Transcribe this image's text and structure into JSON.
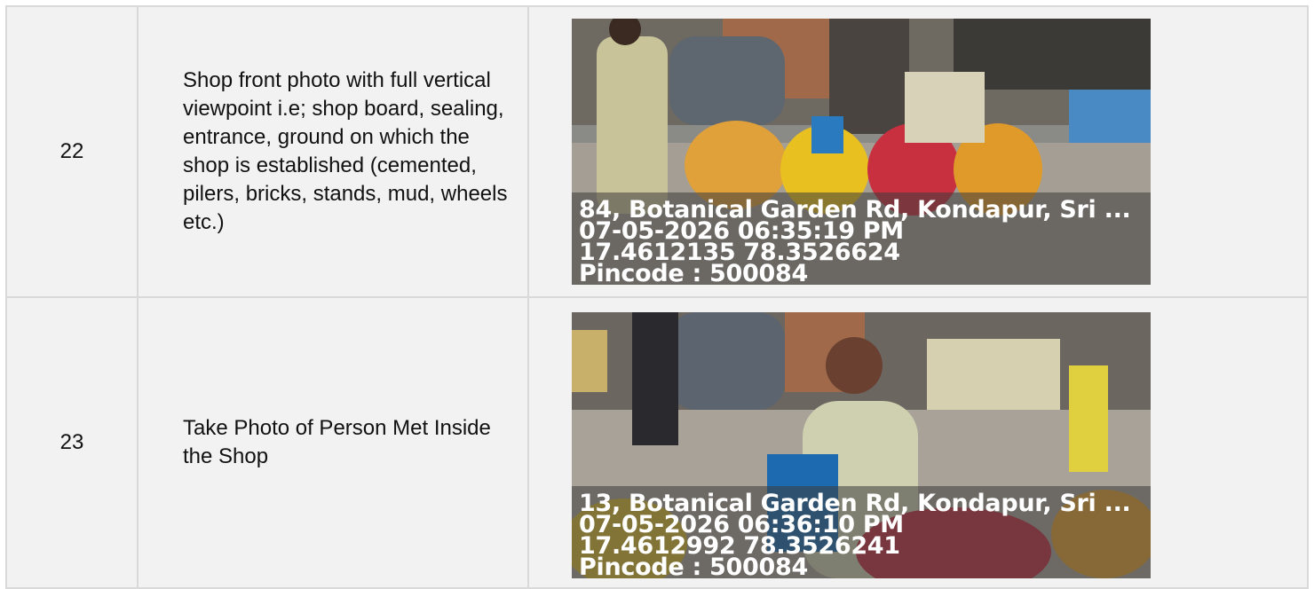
{
  "rows": [
    {
      "number": "22",
      "description": "Shop front photo with full vertical viewpoint i.e; shop board, sealing, entrance, ground on which the shop is established (cemented, pilers, bricks, stands, mud, wheels etc.)",
      "photo": {
        "address": "84, Botanical Garden Rd, Kondapur, Sri ...",
        "datetime": "07-05-2026 06:35:19 PM",
        "coordinates": "17.4612135 78.3526624",
        "pincode": "Pincode : 500084"
      }
    },
    {
      "number": "23",
      "description": "Take Photo of Person Met Inside the Shop",
      "photo": {
        "address": "13, Botanical Garden Rd, Kondapur, Sri ...",
        "datetime": "07-05-2026 06:36:10 PM",
        "coordinates": "17.4612992 78.3526241",
        "pincode": "Pincode : 500084"
      }
    }
  ],
  "colors": {
    "border": "#d9d9d9",
    "cell_bg": "#f2f2f2",
    "stamp_text": "#ffffff"
  }
}
